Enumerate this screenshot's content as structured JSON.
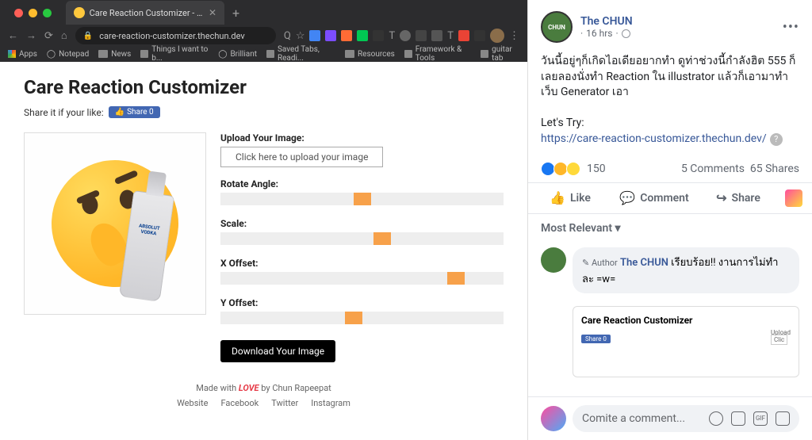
{
  "browser": {
    "tab_title": "Care Reaction Customizer - Ch",
    "url": "care-reaction-customizer.thechun.dev",
    "bookmarks": [
      "Apps",
      "Notepad",
      "News",
      "Things I want to b...",
      "Brilliant",
      "Saved Tabs, Readi...",
      "Resources",
      "Framework & Tools",
      "guitar tab"
    ]
  },
  "page": {
    "title": "Care Reaction Customizer",
    "share_label": "Share it if your like:",
    "share_btn": "Share 0",
    "bottle_text": "ABSOLUT VODKA",
    "controls": {
      "upload_label": "Upload Your Image:",
      "upload_btn": "Click here to upload your image",
      "rotate_label": "Rotate Angle:",
      "scale_label": "Scale:",
      "xoffset_label": "X Offset:",
      "yoffset_label": "Y Offset:",
      "download_btn": "Download Your Image"
    },
    "footer_pre": "Made with ",
    "footer_love": "LOVE",
    "footer_post": " by Chun Rapeepat",
    "footer_links": [
      "Website",
      "Facebook",
      "Twitter",
      "Instagram"
    ]
  },
  "post": {
    "author": "The CHUN",
    "avatar_text": "CHUN",
    "time": "16 hrs",
    "body_line1": "วันนี้อยู่ๆก็เกิดไอเดียอยากทำ ดูท่าช่วงนี้กำลังฮิต 555 ก็เลยลองนั่งทำ Reaction ใน illustrator แล้วก็เอามาทำเว็บ Generator เอา",
    "lets_try": "Let's Try:",
    "link": "https://care-reaction-customizer.thechun.dev/",
    "react_count": "150",
    "comments": "5 Comments",
    "shares": "65 Shares",
    "like_label": "Like",
    "comment_label": "Comment",
    "share_label": "Share",
    "filter": "Most Relevant ▾",
    "comment1_badge": "✎ Author",
    "comment1_author": "The CHUN",
    "comment1_text": " เรียบร้อย!! งานการไม่ทำละ =w=",
    "preview_title": "Care Reaction Customizer",
    "preview_share": "Share 0",
    "preview_upload": "Upload",
    "preview_click": "Clic",
    "input_placeholder": "Comite a comment..."
  }
}
